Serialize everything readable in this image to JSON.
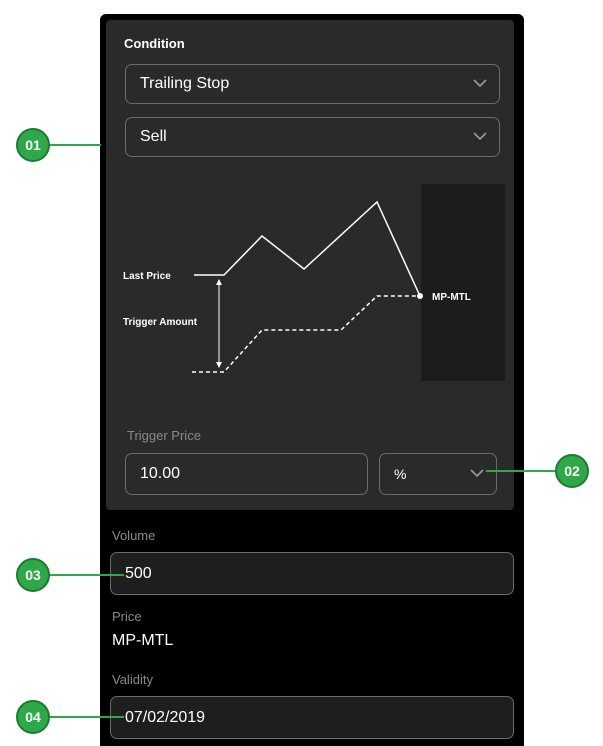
{
  "condition": {
    "title": "Condition",
    "type_value": "Trailing Stop",
    "side_value": "Sell"
  },
  "diagram": {
    "last_price_label": "Last Price",
    "trigger_amount_label": "Trigger Amount",
    "end_label": "MP-MTL"
  },
  "trigger": {
    "label": "Trigger Price",
    "value": "10.00",
    "unit": "%"
  },
  "volume": {
    "label": "Volume",
    "value": "500"
  },
  "price": {
    "label": "Price",
    "value": "MP-MTL"
  },
  "validity": {
    "label": "Validity",
    "value": "07/02/2019"
  },
  "callouts": [
    "01",
    "02",
    "03",
    "04"
  ],
  "colors": {
    "accent_green": "#2fa84a",
    "panel": "#000000",
    "card": "#2a2a2a"
  }
}
